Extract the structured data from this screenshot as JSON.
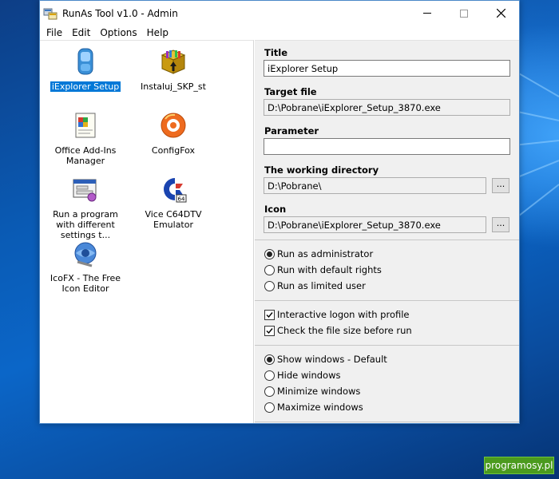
{
  "window": {
    "title": "RunAs Tool v1.0 - Admin",
    "minimize_glyph": "",
    "close_glyph": ""
  },
  "menu": [
    "File",
    "Edit",
    "Options",
    "Help"
  ],
  "programs": [
    {
      "label": "iExplorer Setup",
      "icon": "iexplorer-icon",
      "selected": true
    },
    {
      "label": "Instaluj_SKP_st",
      "icon": "package-icon",
      "selected": false
    },
    {
      "label": "Office Add-Ins Manager",
      "icon": "office-addins-icon",
      "selected": false
    },
    {
      "label": "ConfigFox",
      "icon": "configfox-icon",
      "selected": false
    },
    {
      "label": "Run a program with different settings t...",
      "icon": "run-program-icon",
      "selected": false
    },
    {
      "label": "Vice C64DTV Emulator",
      "icon": "commodore-icon",
      "selected": false
    },
    {
      "label": "IcoFX - The Free Icon Editor",
      "icon": "icofx-icon",
      "selected": false
    }
  ],
  "details": {
    "title_label": "Title",
    "title_value": "iExplorer Setup",
    "target_label": "Target file",
    "target_value": "D:\\Pobrane\\iExplorer_Setup_3870.exe",
    "parameter_label": "Parameter",
    "parameter_value": "",
    "workdir_label": "The working directory",
    "workdir_value": "D:\\Pobrane\\",
    "icon_label": "Icon",
    "icon_value": "D:\\Pobrane\\iExplorer_Setup_3870.exe",
    "browse_label": "..."
  },
  "run_mode": {
    "options": [
      "Run as administrator",
      "Run with default rights",
      "Run as limited user"
    ],
    "selected": 0
  },
  "checks": {
    "interactive_logon": {
      "label": "Interactive logon with profile",
      "checked": true
    },
    "check_size": {
      "label": "Check the file size before run",
      "checked": true
    }
  },
  "window_mode": {
    "options": [
      "Show windows - Default",
      "Hide windows",
      "Minimize windows",
      "Maximize windows"
    ],
    "selected": 0
  },
  "watermark": "programosy.pl",
  "colors": {
    "selection": "#0078d7",
    "watermark": "#4b9a1e"
  }
}
